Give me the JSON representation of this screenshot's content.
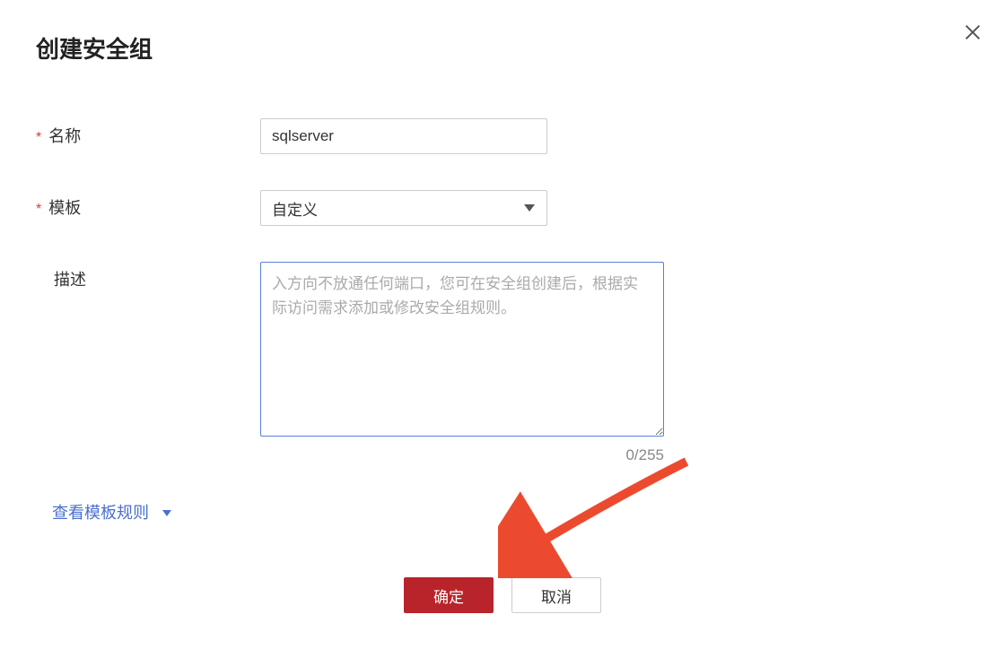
{
  "modal": {
    "title": "创建安全组"
  },
  "form": {
    "name": {
      "label": "名称",
      "value": "sqlserver",
      "required": true
    },
    "template": {
      "label": "模板",
      "selected": "自定义",
      "required": true
    },
    "description": {
      "label": "描述",
      "value": "",
      "placeholder": "入方向不放通任何端口，您可在安全组创建后，根据实际访问需求添加或修改安全组规则。",
      "counter": "0/255"
    }
  },
  "links": {
    "viewTemplateRules": "查看模板规则"
  },
  "buttons": {
    "confirm": "确定",
    "cancel": "取消"
  },
  "symbols": {
    "required": "*"
  }
}
